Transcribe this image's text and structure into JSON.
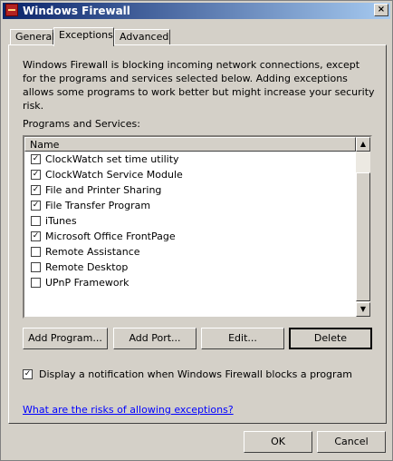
{
  "window": {
    "title": "Windows Firewall",
    "close_glyph": "×"
  },
  "tabs": [
    {
      "label": "General"
    },
    {
      "label": "Exceptions"
    },
    {
      "label": "Advanced"
    }
  ],
  "description": "Windows Firewall is blocking incoming network connections, except for the programs and services selected below. Adding exceptions allows some programs to work better but might increase your security risk.",
  "programs": {
    "label": "Programs and Services:",
    "column_header": "Name",
    "items": [
      {
        "label": "ClockWatch set time utility",
        "checked": true
      },
      {
        "label": "ClockWatch Service Module",
        "checked": true
      },
      {
        "label": "File and Printer Sharing",
        "checked": true
      },
      {
        "label": "File Transfer Program",
        "checked": true
      },
      {
        "label": "iTunes",
        "checked": false
      },
      {
        "label": "Microsoft Office FrontPage",
        "checked": true
      },
      {
        "label": "Remote Assistance",
        "checked": false
      },
      {
        "label": "Remote Desktop",
        "checked": false
      },
      {
        "label": "UPnP Framework",
        "checked": false
      }
    ]
  },
  "buttons": {
    "add_program": "Add Program...",
    "add_port": "Add Port...",
    "edit": "Edit...",
    "delete": "Delete",
    "ok": "OK",
    "cancel": "Cancel"
  },
  "notification": {
    "label": "Display a notification when Windows Firewall blocks a program",
    "checked": true
  },
  "link": "What are the risks of allowing exceptions?",
  "scrollbar": {
    "up_glyph": "▲",
    "down_glyph": "▼"
  }
}
